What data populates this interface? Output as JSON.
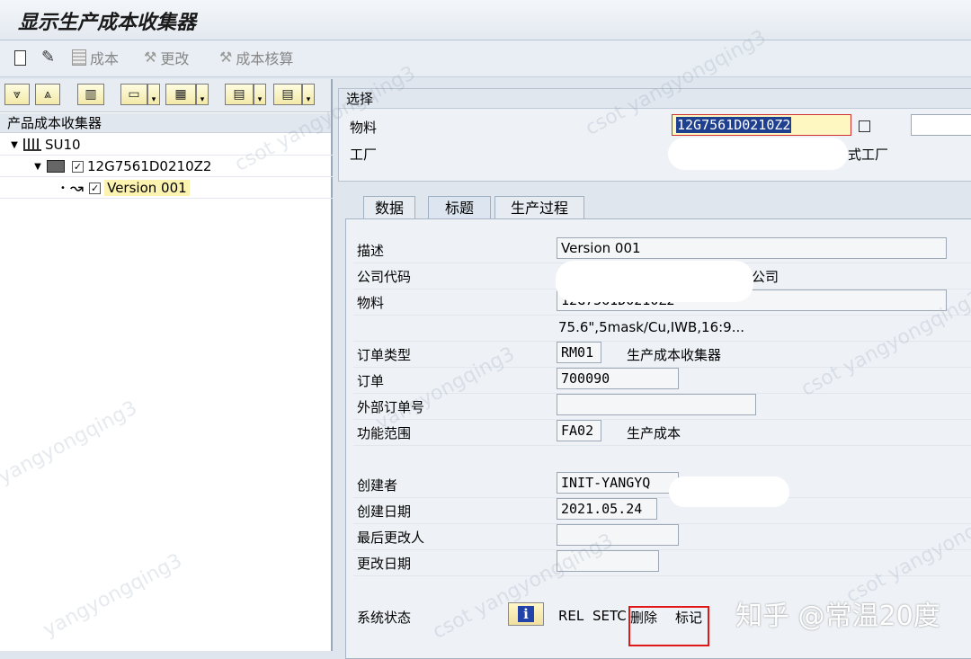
{
  "window": {
    "title": "显示生产成本收集器"
  },
  "app_toolbar": {
    "cost_label": "成本",
    "change_label": "更改",
    "cost_calc_label": "成本核算"
  },
  "tree": {
    "header": "产品成本收集器",
    "nodes": [
      {
        "label": "SU10"
      },
      {
        "label": "12G7561D0210Z2"
      },
      {
        "label": "Version 001"
      }
    ]
  },
  "selection": {
    "title": "选择",
    "material_label": "物料",
    "material_value": "12G7561D0210Z2",
    "plant_label": "工厂",
    "plant_suffix": "式工厂"
  },
  "tabs": [
    {
      "label": "数据"
    },
    {
      "label": "标题"
    },
    {
      "label": "生产过程"
    }
  ],
  "form": {
    "description_label": "描述",
    "description_value": "Version 001",
    "company_code_label": "公司代码",
    "company_code_suffix": "限公司",
    "material_label": "物料",
    "material_value": "12G7561D0210Z2",
    "material_text": "75.6\",5mask/Cu,IWB,16:9...",
    "order_type_label": "订单类型",
    "order_type_value": "RM01",
    "order_type_text": "生产成本收集器",
    "order_label": "订单",
    "order_value": "700090",
    "ext_order_label": "外部订单号",
    "ext_order_value": "",
    "func_area_label": "功能范围",
    "func_area_value": "FA02",
    "func_area_text": "生产成本",
    "created_by_label": "创建者",
    "created_by_value": "INIT-YANGYQ",
    "created_date_label": "创建日期",
    "created_date_value": "2021.05.24",
    "changed_by_label": "最后更改人",
    "changed_by_value": "",
    "changed_date_label": "更改日期",
    "changed_date_value": "",
    "status_label": "系统状态",
    "status_rel": "REL",
    "status_setc": "SETC",
    "status_delete": "删除",
    "status_mark": "标记"
  },
  "watermarks": {
    "text_a": "csot yangyongqing3",
    "text_b": "yangyongqing3",
    "credit": "知乎 @常温20度"
  },
  "colors": {
    "highlight_box": "#e01818",
    "selected_input": "#fff7c2"
  }
}
